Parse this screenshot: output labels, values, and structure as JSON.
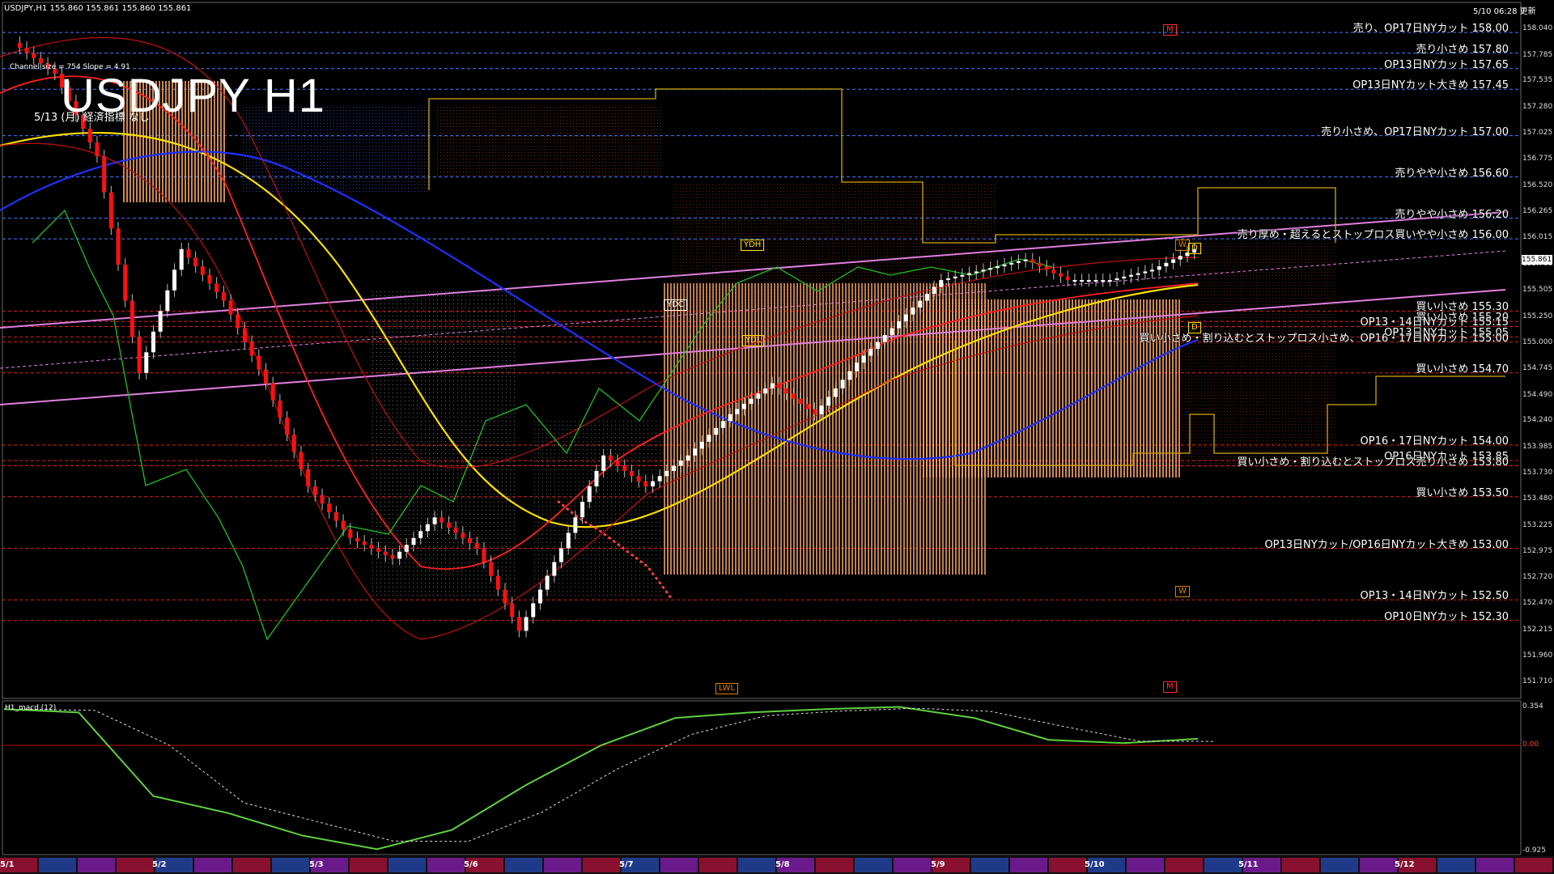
{
  "header": {
    "symbol_info": "USDJPY,H1  155.860 155.861 155.860 155.861",
    "updated": "5/10 06:28 更新",
    "title": "USDJPY H1",
    "subtitle": "5/13 (月) 経済指標 なし",
    "channel_info": "Channel size = 754 Slope = 4.91"
  },
  "levels": [
    {
      "label": "売り、OP17日NYカット 158.00",
      "price": 158.0,
      "color": "#4a7cff"
    },
    {
      "label": "売り小さめ 157.80",
      "price": 157.8,
      "color": "#4a7cff"
    },
    {
      "label": "OP13日NYカット 157.65",
      "price": 157.65,
      "color": "#4a7cff"
    },
    {
      "label": "OP13日NYカット大きめ 157.45",
      "price": 157.45,
      "color": "#4a7cff"
    },
    {
      "label": "売り小さめ、OP17日NYカット 157.00",
      "price": 157.0,
      "color": "#4a7cff"
    },
    {
      "label": "売りやや小さめ 156.60",
      "price": 156.6,
      "color": "#4a7cff"
    },
    {
      "label": "売りやや小さめ 156.20",
      "price": 156.2,
      "color": "#4a7cff"
    },
    {
      "label": "売り厚め・超えるとストップロス買いやや小さめ 156.00",
      "price": 156.0,
      "color": "#4a7cff"
    },
    {
      "label": "買い小さめ 155.30",
      "price": 155.3,
      "color": "#e02020"
    },
    {
      "label": "買い小さめ 155.20",
      "price": 155.2,
      "color": "#e02020"
    },
    {
      "label": "OP13・14日NYカット 155.15",
      "price": 155.15,
      "color": "#e02020"
    },
    {
      "label": "OP13日NYカット 155.05",
      "price": 155.05,
      "color": "#e02020"
    },
    {
      "label": "買い小さめ・割り込むとストップロス小さめ、OP16・17日NYカット 155.00",
      "price": 155.0,
      "color": "#e02020"
    },
    {
      "label": "買い小さめ 154.70",
      "price": 154.7,
      "color": "#e02020"
    },
    {
      "label": "OP16・17日NYカット 154.00",
      "price": 154.0,
      "color": "#e02020"
    },
    {
      "label": "OP16日NYカット 153.85",
      "price": 153.85,
      "color": "#e02020"
    },
    {
      "label": "買い小さめ・割り込むとストップロス売り小さめ 153.80",
      "price": 153.8,
      "color": "#e02020"
    },
    {
      "label": "買い小さめ 153.50",
      "price": 153.5,
      "color": "#e02020"
    },
    {
      "label": "OP13日NYカット/OP16日NYカット大きめ 153.00",
      "price": 153.0,
      "color": "#e02020"
    },
    {
      "label": "OP13・14日NYカット 152.50",
      "price": 152.5,
      "color": "#e02020"
    },
    {
      "label": "OP10日NYカット 152.30",
      "price": 152.3,
      "color": "#e02020"
    }
  ],
  "price_axis": [
    "158.040",
    "157.785",
    "157.535",
    "157.280",
    "157.025",
    "156.775",
    "156.520",
    "156.265",
    "156.015",
    "155.760",
    "155.505",
    "155.250",
    "155.000",
    "154.745",
    "154.490",
    "154.240",
    "153.985",
    "153.730",
    "153.480",
    "153.225",
    "152.975",
    "152.720",
    "152.470",
    "152.215",
    "151.960",
    "151.710"
  ],
  "current_price": "155.861",
  "date_axis": [
    "5/1",
    "5/2",
    "5/3",
    "5/6",
    "5/7",
    "5/8",
    "5/9",
    "5/10",
    "5/11",
    "5/12"
  ],
  "tags": {
    "ydh": "YDH",
    "ydc": "YDC",
    "ydl": "YDL",
    "lwl": "LWL",
    "w": "W",
    "d": "D",
    "m": "M"
  },
  "macd": {
    "label": "H1_macd (12)",
    "axis": [
      "0.354",
      "0.00",
      "-0.925"
    ]
  },
  "chart_data": {
    "type": "line",
    "title": "USDJPY H1",
    "ylim": [
      151.71,
      158.04
    ],
    "series": [
      {
        "values": [
          157.9,
          157.6,
          156.8,
          154.7,
          155.9,
          155.4,
          154.6,
          153.6,
          153.1,
          152.9,
          153.3,
          153.0,
          152.2,
          153.0,
          153.9,
          153.6,
          153.9,
          154.3,
          154.6,
          154.3,
          154.8,
          155.2,
          155.6,
          155.7,
          155.8,
          155.6,
          155.6,
          155.7,
          155.9
        ]
      }
    ],
    "macd_values": [
      0.33,
      0.3,
      -0.45,
      -0.6,
      -0.8,
      -0.92,
      -0.75,
      -0.35,
      0.0,
      0.25,
      0.3,
      0.33,
      0.35,
      0.25,
      0.05,
      0.02,
      0.06
    ]
  }
}
